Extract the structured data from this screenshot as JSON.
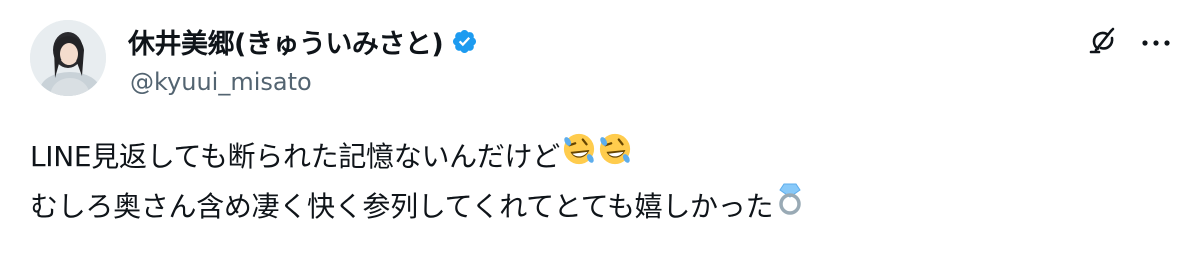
{
  "author": {
    "display_name": "休井美郷(きゅういみさと)",
    "handle": "@kyuui_misato",
    "verified_icon": "verified-badge-icon",
    "verified_color": "#1d9bf0"
  },
  "actions": {
    "grok_icon": "grok-icon",
    "more_icon": "more-icon"
  },
  "tweet": {
    "line1": "LINE見返しても断られた記憶ないんだけど",
    "line1_emojis": [
      "rolling-on-floor-laughing-emoji",
      "rolling-on-floor-laughing-emoji"
    ],
    "line2": "むしろ奥さん含め凄く快く参列してくれてとても嬉しかった",
    "line2_emojis": [
      "ring-emoji"
    ]
  },
  "colors": {
    "text_primary": "#0f1419",
    "text_secondary": "#536471",
    "background": "#ffffff"
  }
}
